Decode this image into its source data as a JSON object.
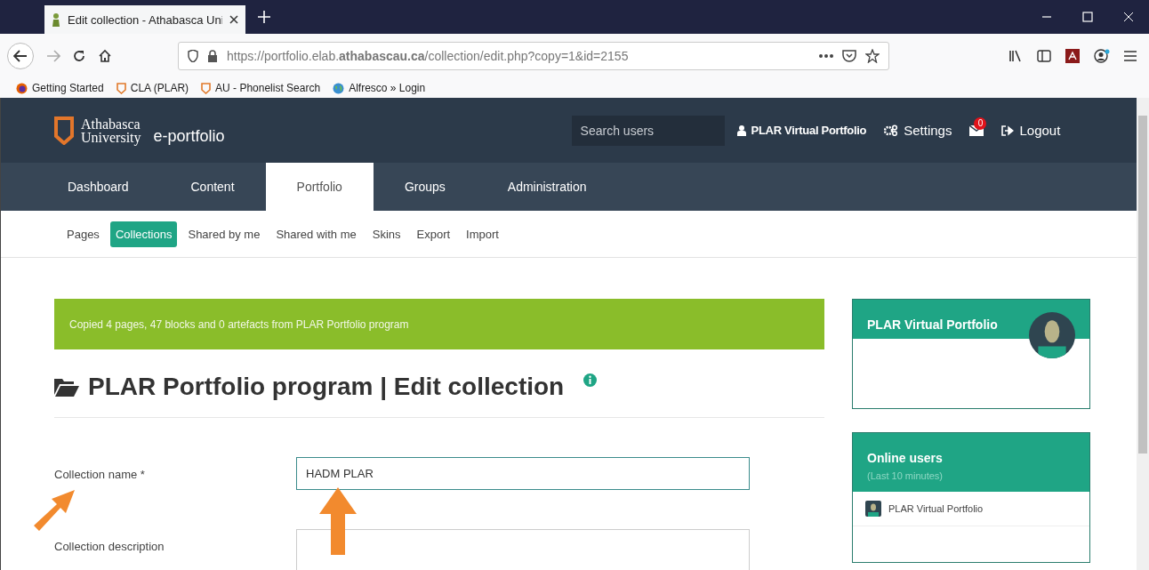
{
  "browser": {
    "tabs": [
      {
        "title": "Edit collection - Athabasca Uni",
        "selected": true
      }
    ],
    "url": "https://portfolio.elab.**athabascau.ca**/collection/edit.php?copy=1&id=2155",
    "bookmarks": [
      {
        "label": "Getting Started",
        "kind": "firefox"
      },
      {
        "label": "CLA (PLAR)",
        "kind": "shield"
      },
      {
        "label": "AU - Phonelist Search",
        "kind": "shield"
      },
      {
        "label": "Alfresco » Login",
        "kind": "globe"
      }
    ]
  },
  "site": {
    "logo": {
      "line1": "Athabasca",
      "line2": "University",
      "product": "e-portfolio"
    },
    "search": {
      "placeholder": "Search users"
    },
    "user": "PLAR Virtual Portfolio",
    "settings": "Settings",
    "notifications": "0",
    "logout": "Logout"
  },
  "nav": [
    {
      "label": "Dashboard",
      "selected": false
    },
    {
      "label": "Content",
      "selected": false
    },
    {
      "label": "Portfolio",
      "selected": true
    },
    {
      "label": "Groups",
      "selected": false
    },
    {
      "label": "Administration",
      "selected": false
    }
  ],
  "subnav": [
    {
      "label": "Pages",
      "selected": false
    },
    {
      "label": "Collections",
      "selected": true
    },
    {
      "label": "Shared by me",
      "selected": false
    },
    {
      "label": "Shared with me",
      "selected": false
    },
    {
      "label": "Skins",
      "selected": false
    },
    {
      "label": "Export",
      "selected": false
    },
    {
      "label": "Import",
      "selected": false
    }
  ],
  "alert": "Copied 4 pages, 47 blocks and 0 artefacts from PLAR Portfolio program",
  "heading": "PLAR Portfolio program | Edit collection",
  "form": [
    {
      "label": "Collection name *",
      "value": "HADM PLAR",
      "kind": "text"
    },
    {
      "label": "Collection description",
      "kind": "textarea"
    }
  ],
  "sidebar": {
    "profile": {
      "title": "PLAR Virtual Portfolio"
    },
    "online": {
      "title": "Online users",
      "subtitle": "(Last 10 minutes)",
      "users": [
        "PLAR Virtual Portfolio"
      ]
    }
  }
}
